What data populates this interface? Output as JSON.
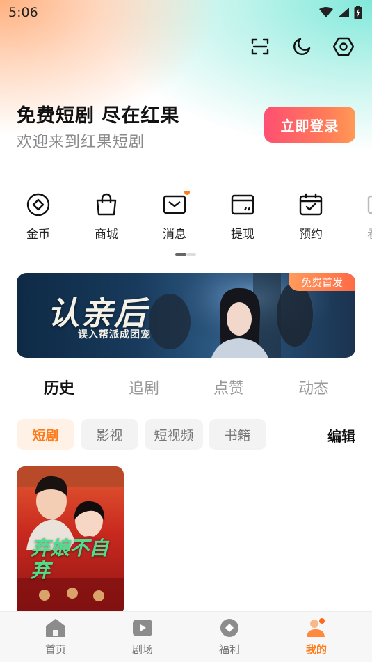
{
  "status_bar": {
    "time": "5:06"
  },
  "header": {
    "slogan": "免费短剧 尽在红果",
    "welcome": "欢迎来到红果短剧",
    "login_label": "立即登录"
  },
  "top_actions": [
    "scan-icon",
    "moon-icon",
    "settings-icon"
  ],
  "quick_actions": [
    {
      "label": "金币",
      "icon": "coin-icon"
    },
    {
      "label": "商城",
      "icon": "shopping-bag-icon"
    },
    {
      "label": "消息",
      "icon": "message-icon",
      "badge": true
    },
    {
      "label": "提现",
      "icon": "wallet-icon"
    },
    {
      "label": "预约",
      "icon": "calendar-check-icon"
    },
    {
      "label": "看剧",
      "icon": "tv-icon"
    }
  ],
  "banner": {
    "title": "认亲后",
    "subtitle": "误入帮派成团宠",
    "badge": "免费首发"
  },
  "tabs": [
    {
      "label": "历史",
      "active": true
    },
    {
      "label": "追剧",
      "active": false
    },
    {
      "label": "点赞",
      "active": false
    },
    {
      "label": "动态",
      "active": false
    }
  ],
  "chips": [
    {
      "label": "短剧",
      "active": true
    },
    {
      "label": "影视",
      "active": false
    },
    {
      "label": "短视频",
      "active": false
    },
    {
      "label": "书籍",
      "active": false
    }
  ],
  "edit_label": "编辑",
  "history_items": [
    {
      "title": "弃娘不自弃"
    }
  ],
  "bottom_nav": [
    {
      "label": "首页",
      "icon": "home-icon",
      "active": false
    },
    {
      "label": "剧场",
      "icon": "play-icon",
      "active": false
    },
    {
      "label": "福利",
      "icon": "gift-icon",
      "active": false
    },
    {
      "label": "我的",
      "icon": "profile-icon",
      "active": true
    }
  ],
  "colors": {
    "accent": "#ff7a1a",
    "login_gradient_start": "#ff4f72",
    "login_gradient_end": "#ff9a55",
    "card_title": "#4de08c"
  }
}
